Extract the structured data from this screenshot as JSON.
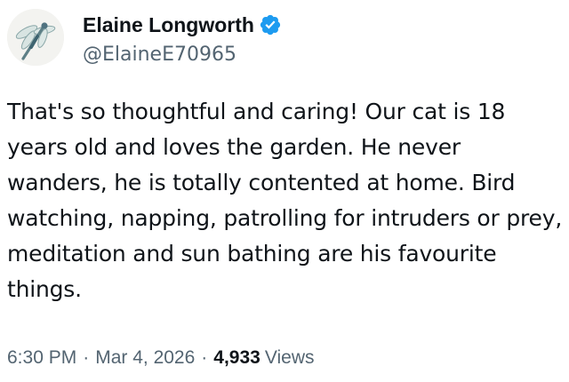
{
  "author": {
    "display_name": "Elaine Longworth",
    "handle": "@ElaineE70965",
    "verified": true,
    "avatar_icon": "dragonfly-icon",
    "verified_icon": "verified-badge-icon",
    "verified_color": "#1d9bf0"
  },
  "tweet": {
    "text": "That's so thoughtful and caring! Our cat is 18 years old and loves the garden. He never wanders, he is totally contented at home. Bird watching, napping, patrolling for intruders or prey, meditation and sun bathing are his favourite things."
  },
  "meta": {
    "time": "6:30 PM",
    "separator": "·",
    "date": "Mar 4, 2026",
    "views_count": "4,933",
    "views_label": "Views"
  }
}
